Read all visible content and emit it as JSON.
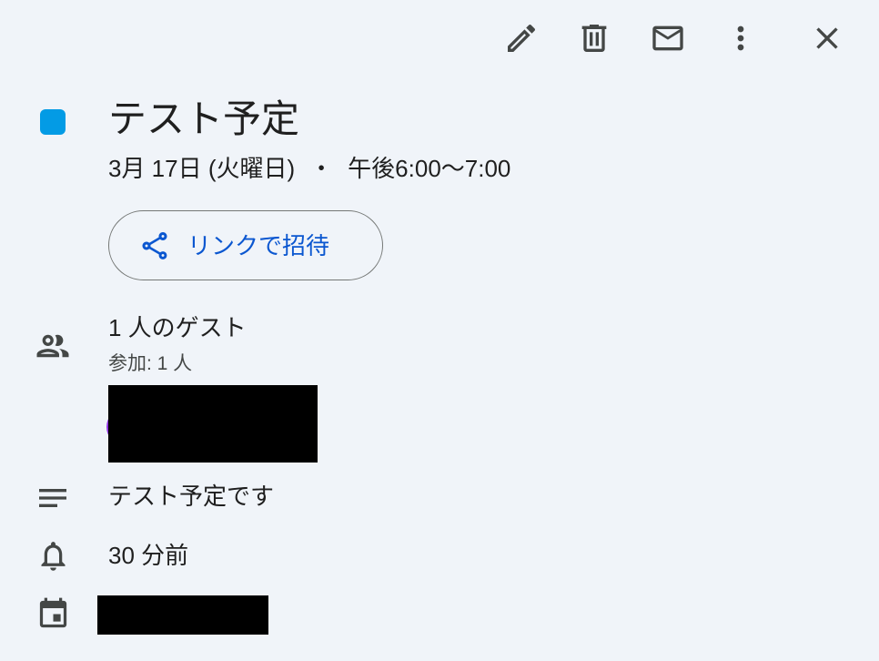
{
  "theme": {
    "background": "#F0F4F9",
    "text_primary": "#1F1F1F",
    "text_secondary": "#444746",
    "icon_color": "#444746",
    "link_color": "#0B57D0",
    "button_border": "#747775",
    "redaction_color": "#000000"
  },
  "toolbar": {
    "buttons": [
      {
        "icon": "edit-icon"
      },
      {
        "icon": "delete-icon"
      },
      {
        "icon": "mail-icon"
      },
      {
        "icon": "more-vert-icon"
      },
      {
        "icon": "close-icon"
      }
    ]
  },
  "event": {
    "color": "#039BE5",
    "title": "テスト予定",
    "date": "3月 17日 (火曜日)",
    "separator": "・",
    "time": "午後6:00〜7:00"
  },
  "invite_button": {
    "icon": "share-icon",
    "label": "リンクで招待"
  },
  "guests": {
    "icon": "people-icon",
    "summary": "1 人のゲスト",
    "attendance": "参加: 1 人",
    "avatar_color": "#9334E6"
  },
  "description": {
    "icon": "notes-icon",
    "text": "テスト予定です"
  },
  "reminder": {
    "icon": "bell-icon",
    "text": "30 分前"
  },
  "calendar": {
    "icon": "calendar-icon"
  }
}
